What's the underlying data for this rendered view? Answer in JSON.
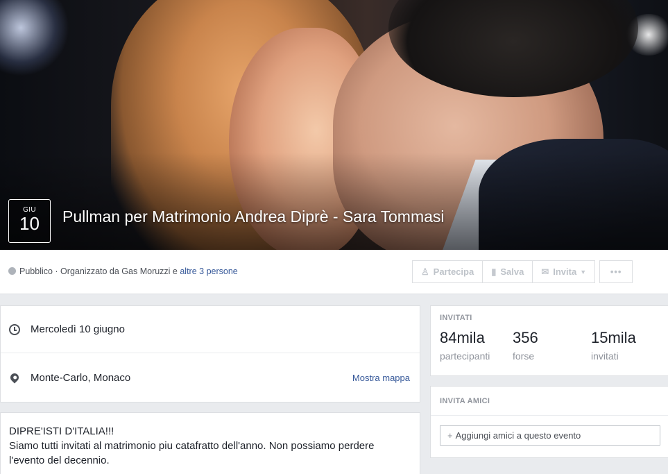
{
  "cover": {
    "date_month": "GIU",
    "date_day": "10",
    "title": "Pullman per Matrimonio Andrea Diprè - Sara Tommasi"
  },
  "action_bar": {
    "privacy_prefix": "Pubblico · Organizzato da Gas Moruzzi e ",
    "privacy_link": "altre 3 persone",
    "buttons": {
      "partecipa": "Partecipa",
      "salva": "Salva",
      "invita": "Invita",
      "more": "•••"
    }
  },
  "details": {
    "date": "Mercoledì 10 giugno",
    "location": "Monte-Carlo, Monaco",
    "map_link": "Mostra mappa"
  },
  "description": {
    "line1": "DIPRE'ISTI D'ITALIA!!!",
    "line2": "Siamo tutti invitati al matrimonio piu catafratto dell'anno. Non possiamo perdere l'evento del decennio."
  },
  "stats": {
    "header": "INVITATI",
    "items": [
      {
        "value": "84mila",
        "label": "partecipanti"
      },
      {
        "value": "356",
        "label": "forse"
      },
      {
        "value": "15mila",
        "label": "invitati"
      }
    ]
  },
  "invite_friends": {
    "header": "INVITA AMICI",
    "input_placeholder": "Aggiungi amici a questo evento"
  },
  "colors": {
    "link": "#365899",
    "muted": "#90949c",
    "background": "#e9ebee"
  }
}
